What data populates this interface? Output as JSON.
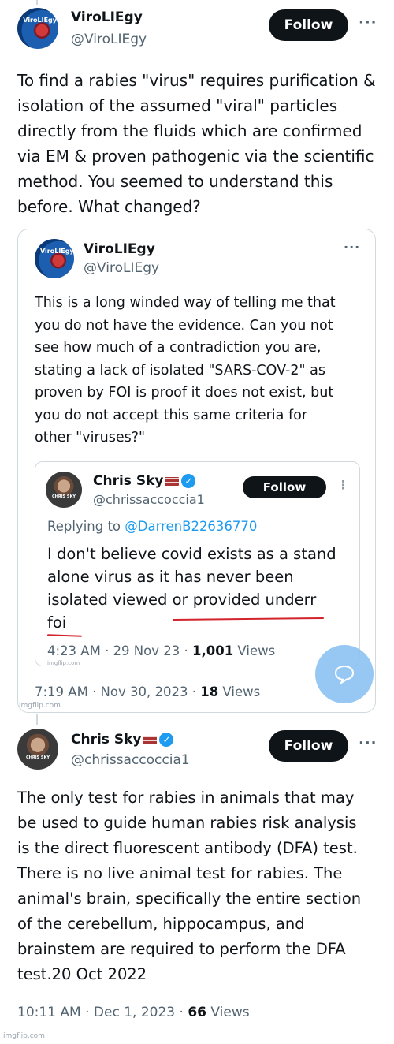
{
  "tweet1": {
    "author_name": "ViroLIEgy",
    "handle": "@ViroLIEgy",
    "avatar_label": "ViroLIEgy",
    "follow_label": "Follow",
    "more_label": "···",
    "lines": [
      "To find a rabies \"virus\" requires purification &",
      "isolation of the assumed \"viral\" particles",
      "directly from the fluids which are confirmed",
      "via EM & proven pathogenic via the scientific",
      "method. You seemed to understand this",
      "before. What changed?"
    ]
  },
  "quote1": {
    "author_name": "ViroLIEgy",
    "handle": "@ViroLIEgy",
    "avatar_label": "ViroLIEgy",
    "more_label": "···",
    "lines": [
      "This is a long winded way of telling me that",
      "you do not have the evidence. Can you not",
      "see how much of a contradiction you are,",
      "stating a lack of isolated \"SARS-COV-2\" as",
      "proven by FOI is proof it does not exist, but",
      "you do not accept this same criteria for",
      "other \"viruses?\""
    ],
    "timestamp": "7:19 AM · Nov 30, 2023 · ",
    "views_count": "18",
    "views_label": " Views",
    "watermark": "imgflip.com"
  },
  "quote2": {
    "author_name": "Chris Sky",
    "handle": "@chrissaccoccia1",
    "avatar_label": "CHRIS SKY",
    "follow_label": "Follow",
    "more_label": "⋮",
    "replying_prefix": "Replying to ",
    "replying_to": "@DarrenB22636770",
    "lines": [
      "I don't believe covid exists as a stand",
      "alone virus as it has never been",
      "isolated viewed or provided underr",
      "foi"
    ],
    "timestamp": "4:23 AM · 29 Nov 23 · ",
    "views_count": "1,001",
    "views_label": " Views",
    "watermark": "imgflip.com"
  },
  "tweet2": {
    "author_name": "Chris Sky",
    "handle": "@chrissaccoccia1",
    "avatar_label": "CHRIS SKY",
    "follow_label": "Follow",
    "more_label": "···",
    "lines": [
      "The only test for rabies in animals that may",
      "be used to guide human rabies risk analysis",
      "is the direct fluorescent antibody (DFA) test.",
      "There is no live animal test for rabies. The",
      "animal's brain, specifically the entire section",
      "of the cerebellum, hippocampus, and",
      "brainstem are required to perform the DFA",
      "test.20 Oct 2022"
    ],
    "timestamp": "10:11 AM · Dec 1, 2023 · ",
    "views_count": "66",
    "views_label": " Views"
  },
  "footer_watermark": "imgflip.com",
  "colors": {
    "accent": "#1d9bf0",
    "text": "#0f1419",
    "muted": "#536471",
    "underline": "#d3242b",
    "bubble": "#8bc3f2"
  }
}
